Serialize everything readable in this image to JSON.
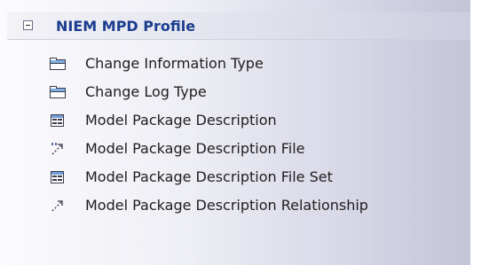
{
  "profile": {
    "title": "NIEM MPD Profile",
    "collapse_icon": "minus-box-icon"
  },
  "items": [
    {
      "label": "Change Information Type",
      "icon": "class-folder-icon"
    },
    {
      "label": "Change Log Type",
      "icon": "class-folder-icon"
    },
    {
      "label": "Model Package Description",
      "icon": "package-element-icon"
    },
    {
      "label": "Model Package Description File",
      "icon": "dependency-relation-icon"
    },
    {
      "label": "Model Package Description File Set",
      "icon": "package-element-icon"
    },
    {
      "label": "Model Package Description Relationship",
      "icon": "dashed-relation-icon"
    }
  ]
}
